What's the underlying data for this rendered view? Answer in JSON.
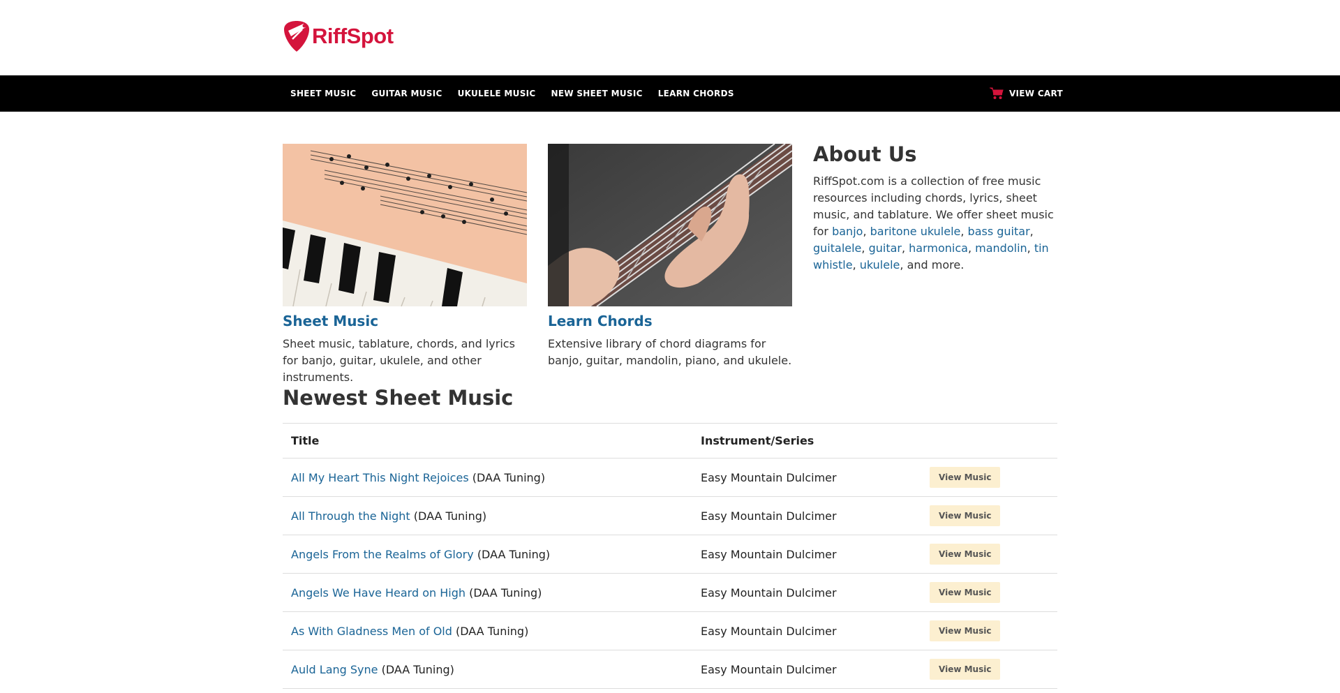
{
  "brand": {
    "name": "RiffSpot",
    "accent": "#d4143c"
  },
  "nav": {
    "items": [
      {
        "label": "SHEET MUSIC"
      },
      {
        "label": "GUITAR MUSIC"
      },
      {
        "label": "UKULELE MUSIC"
      },
      {
        "label": "NEW SHEET MUSIC"
      },
      {
        "label": "LEARN CHORDS"
      }
    ],
    "cart_label": "VIEW CART",
    "cart_icon": "shopping-cart-icon"
  },
  "cards": [
    {
      "title": "Sheet Music",
      "description": "Sheet music, tablature, chords, and lyrics for banjo, guitar, ukulele, and other instruments."
    },
    {
      "title": "Learn Chords",
      "description": "Extensive library of chord diagrams for banjo, guitar, mandolin, piano, and ukulele."
    }
  ],
  "about": {
    "heading": "About Us",
    "intro": "RiffSpot.com is a collection of free music resources including chords, lyrics, sheet music, and tablature. We offer sheet music for ",
    "links": [
      "banjo",
      "baritone ukulele",
      "bass guitar",
      "guitalele",
      "guitar",
      "harmonica",
      "mandolin",
      "tin whistle",
      "ukulele"
    ],
    "outro": ", and more."
  },
  "newest": {
    "heading": "Newest Sheet Music",
    "columns": [
      "Title",
      "Instrument/Series",
      ""
    ],
    "rows": [
      {
        "title": "All My Heart This Night Rejoices",
        "suffix": "(DAA Tuning)",
        "instrument": "Easy Mountain Dulcimer",
        "button": "View Music"
      },
      {
        "title": "All Through the Night",
        "suffix": "(DAA Tuning)",
        "instrument": "Easy Mountain Dulcimer",
        "button": "View Music"
      },
      {
        "title": "Angels From the Realms of Glory",
        "suffix": "(DAA Tuning)",
        "instrument": "Easy Mountain Dulcimer",
        "button": "View Music"
      },
      {
        "title": "Angels We Have Heard on High",
        "suffix": "(DAA Tuning)",
        "instrument": "Easy Mountain Dulcimer",
        "button": "View Music"
      },
      {
        "title": "As With Gladness Men of Old",
        "suffix": "(DAA Tuning)",
        "instrument": "Easy Mountain Dulcimer",
        "button": "View Music"
      },
      {
        "title": "Auld Lang Syne",
        "suffix": "(DAA Tuning)",
        "instrument": "Easy Mountain Dulcimer",
        "button": "View Music"
      }
    ]
  }
}
